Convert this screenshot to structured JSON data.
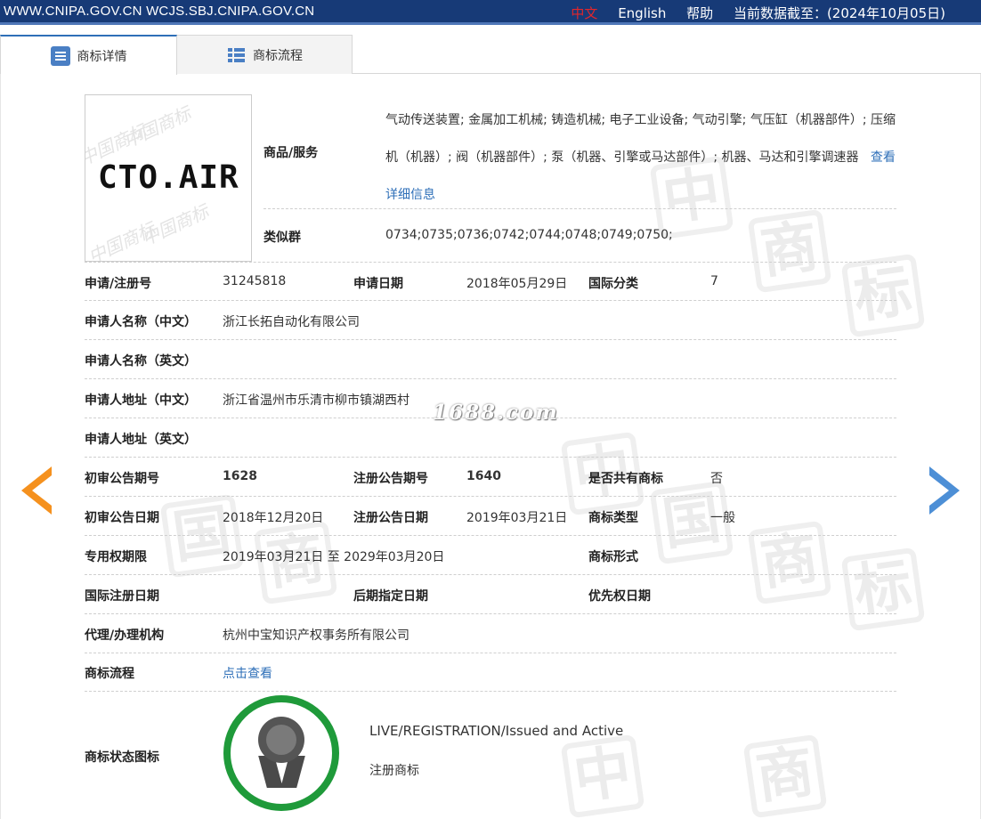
{
  "topbar": {
    "sites": "WWW.CNIPA.GOV.CN WCJS.SBJ.CNIPA.GOV.CN",
    "lang_zh": "中文",
    "lang_en": "English",
    "help": "帮助",
    "data_date": "当前数据截至：(2024年10月05日)"
  },
  "tabs": {
    "detail": "商标详情",
    "flow": "商标流程"
  },
  "logo": {
    "text": "CTO.AIR",
    "stamp_text": "中国商标"
  },
  "goods": {
    "label": "商品/服务",
    "text": "气动传送装置; 金属加工机械; 铸造机械; 电子工业设备; 气动引擎; 气压缸（机器部件）; 压缩机（机器）; 阀（机器部件）; 泵（机器、引擎或马达部件）; 机器、马达和引擎调速器",
    "detail_link": "查看详细信息"
  },
  "similar": {
    "label": "类似群",
    "value": "0734;0735;0736;0742;0744;0748;0749;0750;"
  },
  "fields": {
    "reg_no_label": "申请/注册号",
    "reg_no": "31245818",
    "apply_date_label": "申请日期",
    "apply_date": "2018年05月29日",
    "intl_class_label": "国际分类",
    "intl_class": "7",
    "applicant_cn_label": "申请人名称（中文）",
    "applicant_cn": "浙江长拓自动化有限公司",
    "applicant_en_label": "申请人名称（英文）",
    "applicant_en": "",
    "address_cn_label": "申请人地址（中文）",
    "address_cn": "浙江省温州市乐清市柳市镇湖西村",
    "address_en_label": "申请人地址（英文）",
    "address_en": "",
    "prelim_no_label": "初审公告期号",
    "prelim_no": "1628",
    "reg_notice_no_label": "注册公告期号",
    "reg_notice_no": "1640",
    "shared_label": "是否共有商标",
    "shared": "否",
    "prelim_date_label": "初审公告日期",
    "prelim_date": "2018年12月20日",
    "reg_notice_date_label": "注册公告日期",
    "reg_notice_date": "2019年03月21日",
    "mark_type_label": "商标类型",
    "mark_type": "一般",
    "term_label": "专用权期限",
    "term": "2019年03月21日 至 2029年03月20日",
    "mark_form_label": "商标形式",
    "mark_form": "",
    "intl_reg_date_label": "国际注册日期",
    "intl_reg_date": "",
    "later_date_label": "后期指定日期",
    "later_date": "",
    "priority_label": "优先权日期",
    "priority": "",
    "agent_label": "代理/办理机构",
    "agent": "杭州中宝知识产权事务所有限公司",
    "flow_label": "商标流程",
    "flow_link": "点击查看",
    "status_label": "商标状态图标",
    "status_en": "LIVE/REGISTRATION/Issued and Active",
    "status_cn": "注册商标"
  },
  "watermark": {
    "site": "1688.com",
    "char1": "中",
    "char2": "国",
    "char3": "商",
    "char4": "标"
  },
  "colors": {
    "topbar_bg": "#173a77",
    "accent_link": "#2e6fb8",
    "arrow_prev": "#f5911e",
    "arrow_next": "#4d8fd6",
    "status_ring": "#1f9a3a"
  }
}
